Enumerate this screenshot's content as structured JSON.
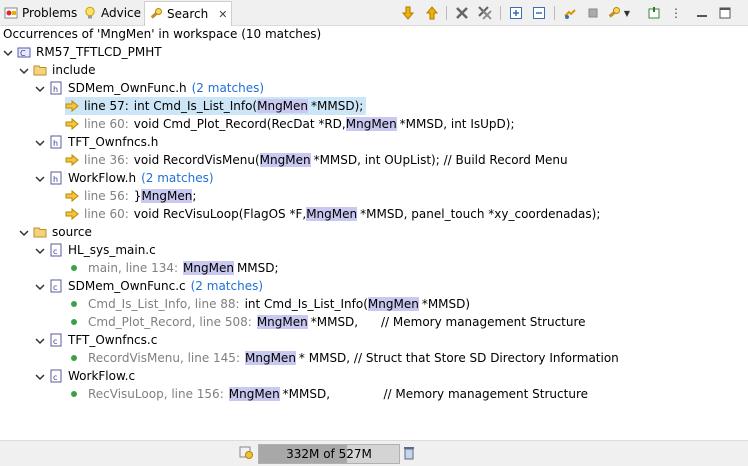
{
  "tabs": [
    {
      "label": "Problems",
      "icon": "problems-icon"
    },
    {
      "label": "Advice",
      "icon": "lightbulb-icon"
    },
    {
      "label": "Search",
      "icon": "search-flashlight-icon"
    }
  ],
  "summary": "Occurrences of 'MngMen' in workspace (10 matches)",
  "tree": {
    "project": "RM57_TFTLCD_PMHT",
    "include": {
      "label": "include",
      "files": [
        {
          "name": "SDMem_OwnFunc.h",
          "count": "(2 matches)",
          "lines": [
            {
              "loc": "line 57:",
              "pre": "int Cmd_Is_List_Info(",
              "match": "MngMen",
              "post": "*MMSD);"
            },
            {
              "loc": "line 60:",
              "pre": "void Cmd_Plot_Record(RecDat *RD, ",
              "match": "MngMen",
              "post": "*MMSD, int IsUpD);"
            }
          ]
        },
        {
          "name": "TFT_Ownfncs.h",
          "count": "",
          "lines": [
            {
              "loc": "line 36:",
              "pre": "void RecordVisMenu(",
              "match": "MngMen",
              "post": "*MMSD, int OUpList); // Build Record Menu"
            }
          ]
        },
        {
          "name": "WorkFlow.h",
          "count": "(2 matches)",
          "lines": [
            {
              "loc": "line 56:",
              "pre": "}",
              "match": "MngMen",
              "post": ";"
            },
            {
              "loc": "line 60:",
              "pre": "void RecVisuLoop(FlagOS *F, ",
              "match": "MngMen",
              "post": "*MMSD, panel_touch *xy_coordenadas);"
            }
          ]
        }
      ]
    },
    "source": {
      "label": "source",
      "files": [
        {
          "name": "HL_sys_main.c",
          "count": "",
          "lines": [
            {
              "loc": "main, line 134:",
              "pre": "",
              "match": "MngMen",
              "post": "MMSD;"
            }
          ]
        },
        {
          "name": "SDMem_OwnFunc.c",
          "count": "(2 matches)",
          "lines": [
            {
              "loc": "Cmd_Is_List_Info, line 88:",
              "pre": "int Cmd_Is_List_Info(",
              "match": "MngMen",
              "post": "*MMSD)"
            },
            {
              "loc": "Cmd_Plot_Record, line 508:",
              "pre": "",
              "match": "MngMen",
              "post": "*MMSD,      // Memory management Structure"
            }
          ]
        },
        {
          "name": "TFT_Ownfncs.c",
          "count": "",
          "lines": [
            {
              "loc": "RecordVisMenu, line 145:",
              "pre": "",
              "match": "MngMen",
              "post": "* MMSD, // Struct that Store SD Directory Information"
            }
          ]
        },
        {
          "name": "WorkFlow.c",
          "count": "",
          "lines": [
            {
              "loc": "RecVisuLoop, line 156:",
              "pre": "",
              "match": "MngMen",
              "post": "*MMSD,              // Memory management Structure"
            }
          ]
        }
      ]
    }
  },
  "status": {
    "heap": "332M of 527M",
    "heap_used_fraction": 0.63
  }
}
